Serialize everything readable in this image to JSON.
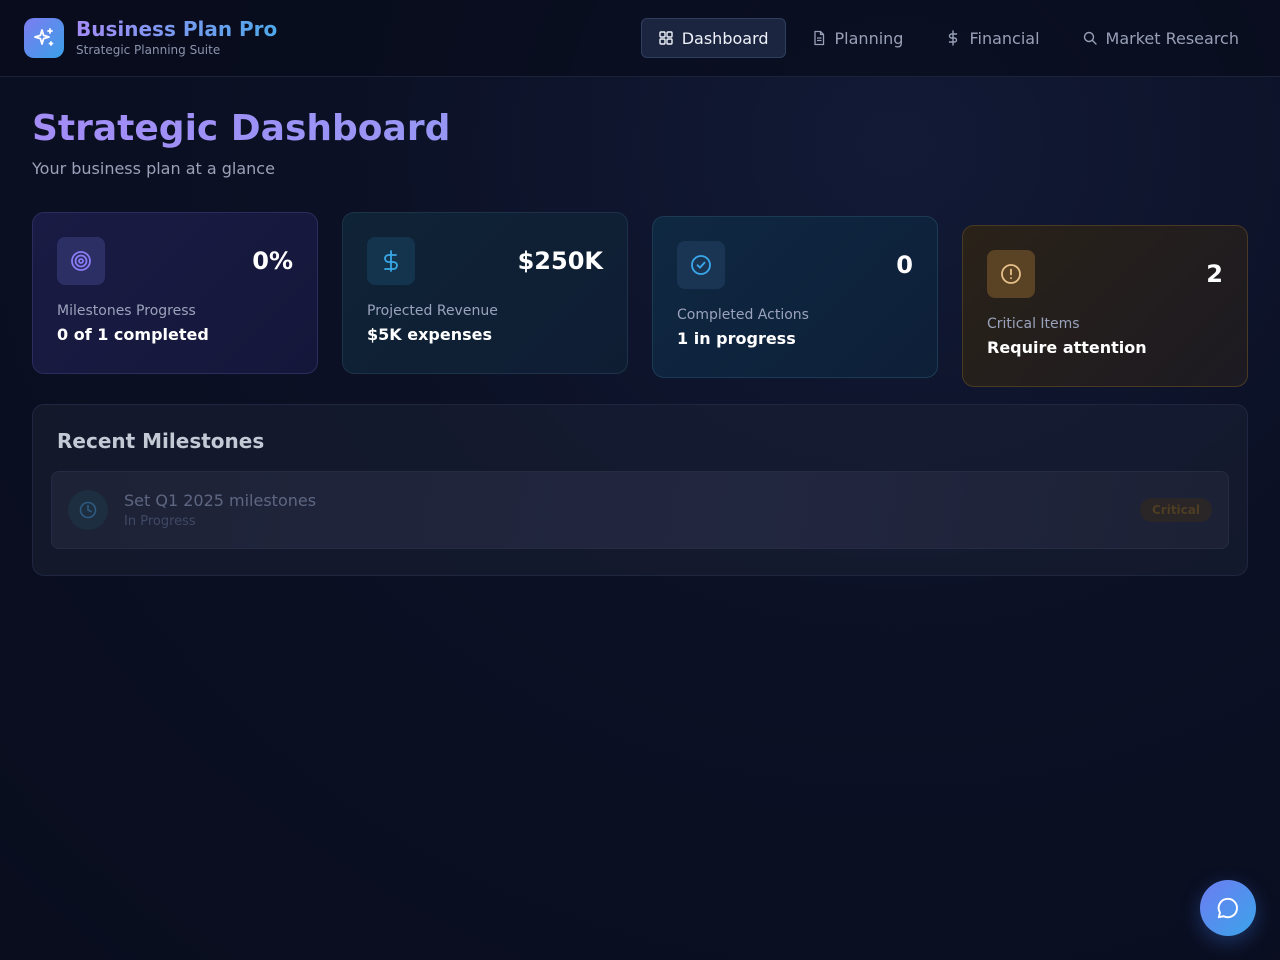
{
  "header": {
    "brand_title": "Business Plan Pro",
    "brand_subtitle": "Strategic Planning Suite",
    "brand_icon": "sparkles-icon",
    "nav": [
      {
        "label": "Dashboard",
        "icon": "grid-icon",
        "active": true
      },
      {
        "label": "Planning",
        "icon": "document-icon",
        "active": false
      },
      {
        "label": "Financial",
        "icon": "dollar-icon",
        "active": false
      },
      {
        "label": "Market Research",
        "icon": "search-icon",
        "active": false
      }
    ]
  },
  "main": {
    "title": "Strategic Dashboard",
    "subtitle": "Your business plan at a glance"
  },
  "cards": [
    {
      "icon": "target-icon",
      "value": "0%",
      "label": "Milestones Progress",
      "detail": "0 of 1 completed",
      "accent": "#8b7cf6"
    },
    {
      "icon": "dollar-icon",
      "value": "$250K",
      "label": "Projected Revenue",
      "detail": "$5K expenses",
      "accent": "#38a8e8"
    },
    {
      "icon": "check-circle-icon",
      "value": "0",
      "label": "Completed Actions",
      "detail": "1 in progress",
      "accent": "#3aa8ec"
    },
    {
      "icon": "alert-circle-icon",
      "value": "2",
      "label": "Critical Items",
      "detail": "Require attention",
      "accent": "#e6b66a"
    }
  ],
  "milestones": {
    "title": "Recent Milestones",
    "items": [
      {
        "name": "Set Q1 2025 milestones",
        "status": "In Progress",
        "badge": "Critical",
        "icon": "clock-icon"
      }
    ]
  },
  "fab": {
    "icon": "chat-bubble-icon"
  }
}
